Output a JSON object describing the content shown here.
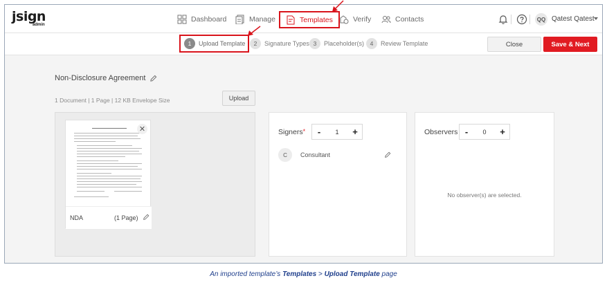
{
  "logo": {
    "main": "jsign",
    "sub": "admin"
  },
  "nav": {
    "items": [
      {
        "label": "Dashboard",
        "icon": "dashboard-icon"
      },
      {
        "label": "Manage",
        "icon": "manage-icon"
      },
      {
        "label": "Templates",
        "icon": "templates-icon",
        "active": true
      },
      {
        "label": "Verify",
        "icon": "verify-icon"
      },
      {
        "label": "Contacts",
        "icon": "contacts-icon"
      }
    ],
    "user_initials": "QQ",
    "user_name": "Qatest Qatest"
  },
  "steps": [
    {
      "num": "1",
      "label": "Upload Template",
      "active": true
    },
    {
      "num": "2",
      "label": "Signature Types"
    },
    {
      "num": "3",
      "label": "Placeholder(s)"
    },
    {
      "num": "4",
      "label": "Review Template"
    }
  ],
  "actions": {
    "close": "Close",
    "save_next": "Save & Next"
  },
  "template": {
    "title": "Non-Disclosure Agreement",
    "meta": "1 Document | 1 Page | 12 KB Envelope Size",
    "upload": "Upload"
  },
  "document": {
    "name": "NDA",
    "pages": "(1 Page)"
  },
  "signers": {
    "label": "Signers",
    "required_mark": "*",
    "count": "1",
    "list": [
      {
        "initial": "C",
        "role": "Consultant"
      }
    ]
  },
  "observers": {
    "label": "Observers",
    "count": "0",
    "empty": "No observer(s) are selected."
  },
  "caption": {
    "prefix": "An imported template’s ",
    "bold1": "Templates",
    "mid": " > ",
    "bold2": "Upload Template",
    "suffix": " page"
  },
  "colors": {
    "brand_red": "#e11b22",
    "highlight_red": "#d9131b",
    "caption_blue": "#1f3f8c"
  }
}
